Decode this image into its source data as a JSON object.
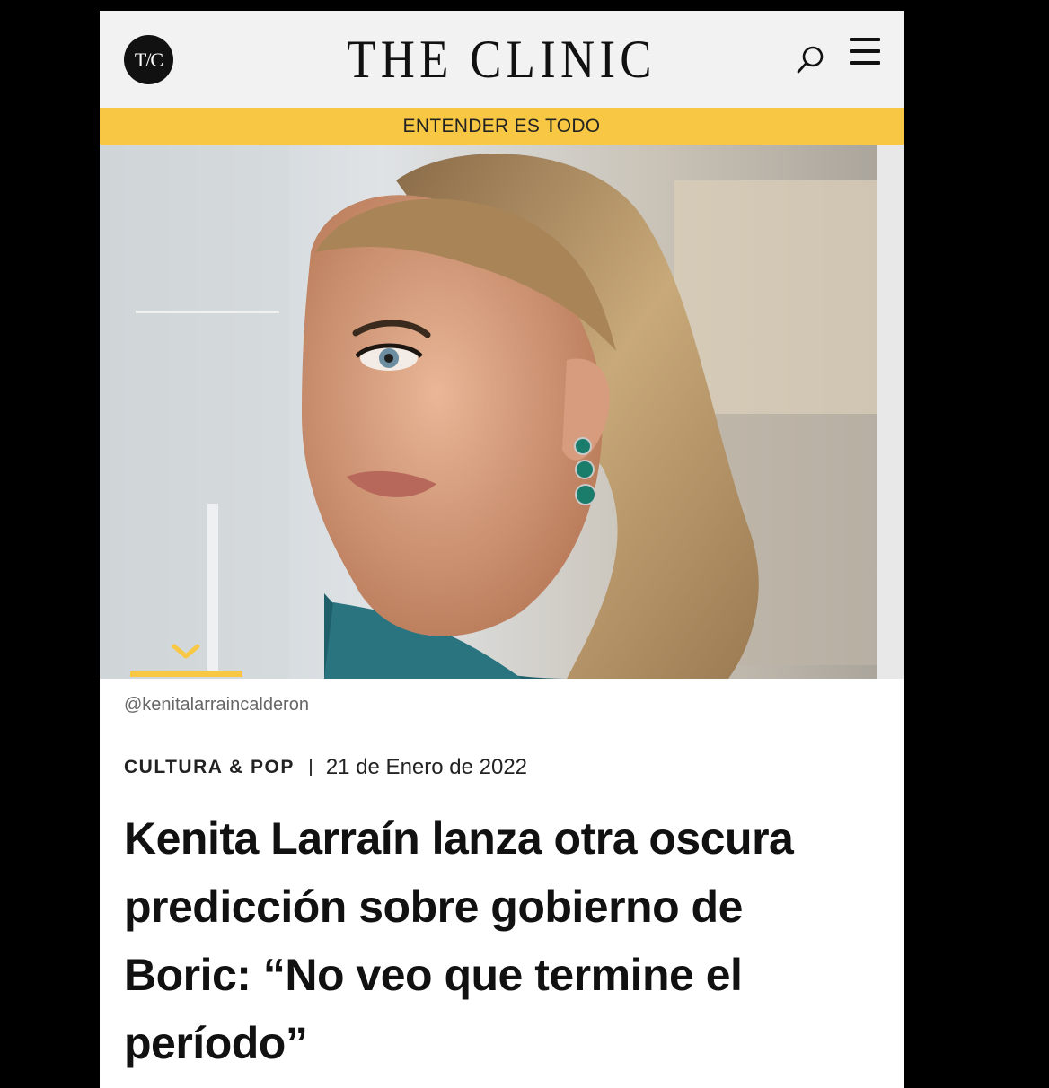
{
  "header": {
    "logo_text": "T/C",
    "brand": "THE CLINIC",
    "icons": [
      "search-icon",
      "menu-icon"
    ]
  },
  "tagline": "ENTENDER ES TODO",
  "hero": {
    "image_label": "Photo of a woman with wavy blonde hair and green drop earrings looking over her shoulder",
    "indicator_icon": "chevron-down-icon"
  },
  "article": {
    "photo_credit": "@kenitalarraincalderon",
    "category": "CULTURA & POP",
    "date": "21 de Enero de 2022",
    "headline": "Kenita Larraín lanza otra oscura predicción sobre gobierno de Boric: “No veo que termine el período”"
  },
  "colors": {
    "accent": "#f8c844",
    "header_bg": "#f2f2f2",
    "text": "#111111"
  }
}
